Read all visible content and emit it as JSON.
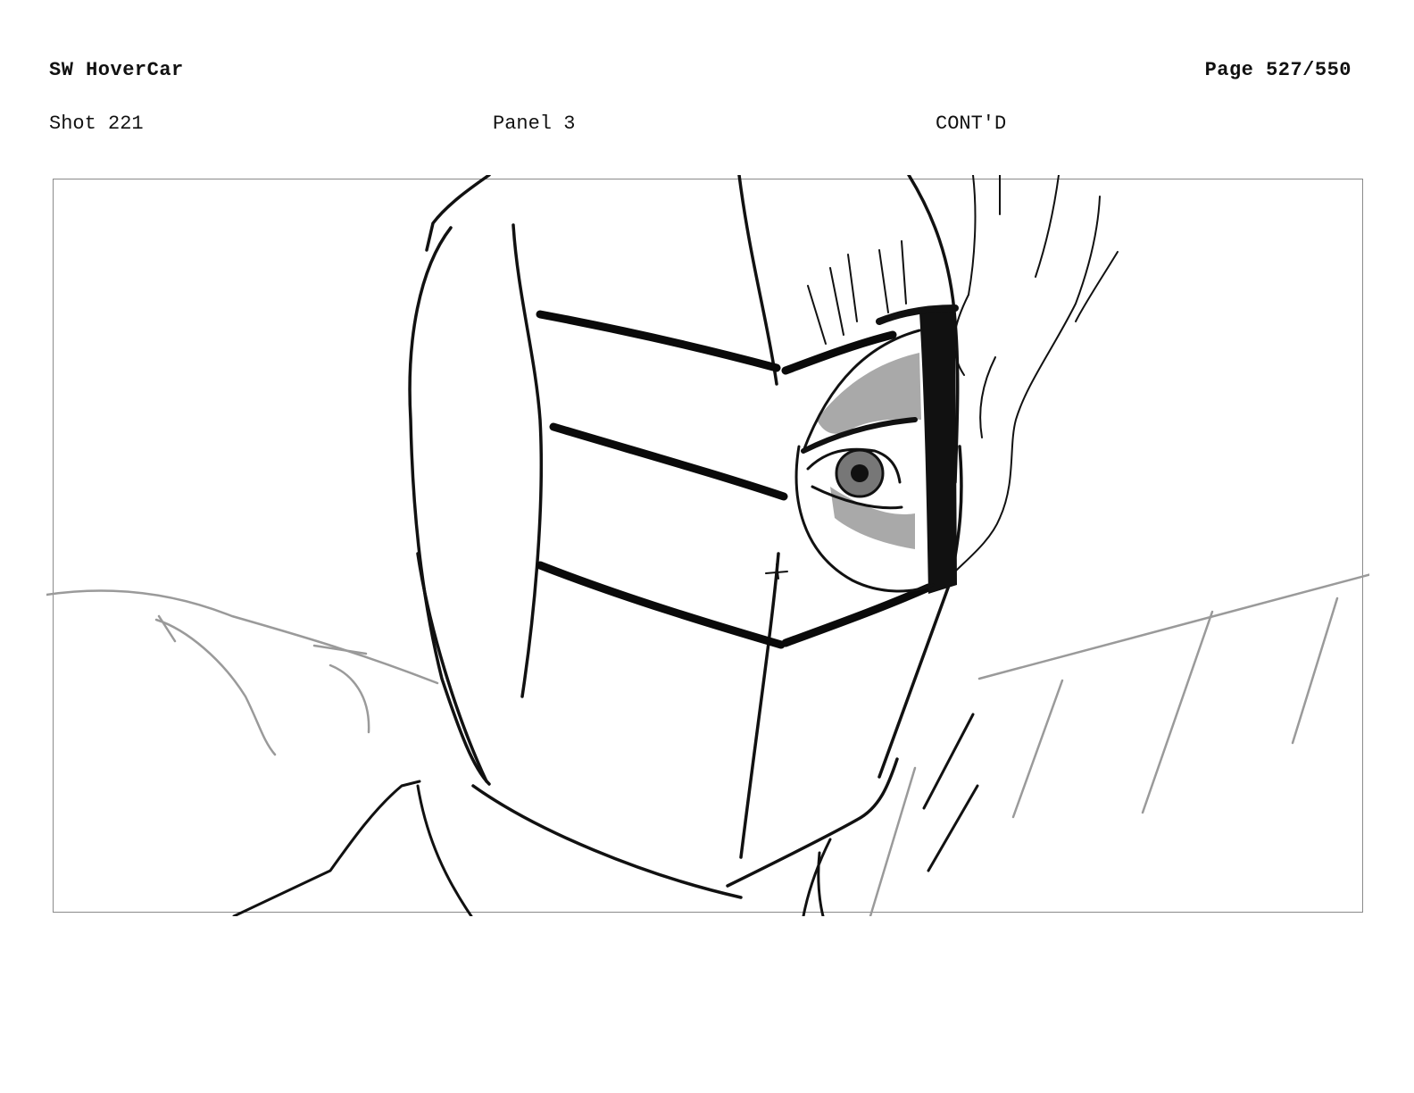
{
  "header": {
    "title": "SW HoverCar",
    "page": "Page 527/550"
  },
  "meta": {
    "shot": "Shot 221",
    "panel": "Panel 3",
    "cont": "CONT'D"
  },
  "panel": {
    "illustration": "masked-character-closeup-sketch"
  }
}
